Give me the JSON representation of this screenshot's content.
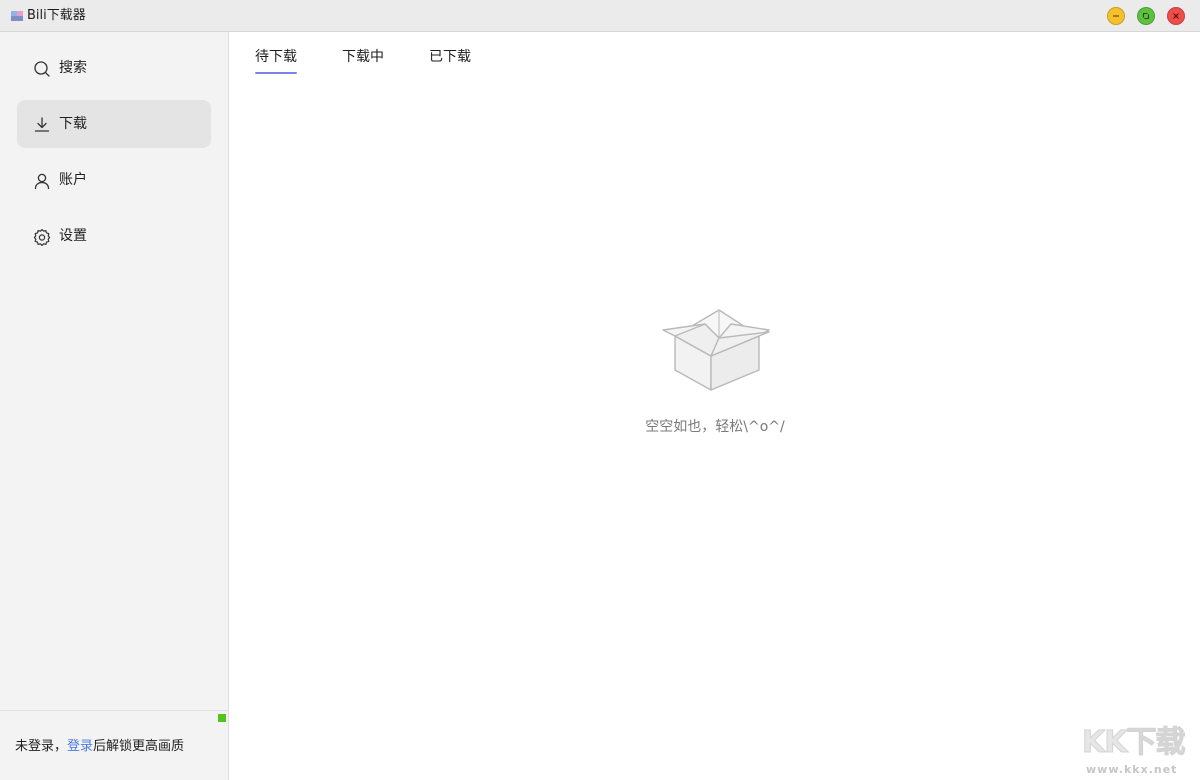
{
  "window": {
    "title": "Bili下载器",
    "buttons": {
      "minimize_icon": "minimize-icon",
      "maximize_icon": "maximize-icon",
      "close_icon": "close-icon"
    },
    "colors": {
      "minimize": "#f6c02d",
      "maximize": "#5fbf3e",
      "close": "#ee4d4a"
    }
  },
  "sidebar": {
    "items": [
      {
        "label": "搜索",
        "icon": "search-icon",
        "active": false
      },
      {
        "label": "下载",
        "icon": "download-icon",
        "active": true
      },
      {
        "label": "账户",
        "icon": "user-icon",
        "active": false
      },
      {
        "label": "设置",
        "icon": "gear-icon",
        "active": false
      }
    ],
    "footer": {
      "prefix": "未登录，",
      "link": "登录",
      "suffix": "后解锁更高画质",
      "status_color": "#52c41a"
    }
  },
  "main": {
    "tabs": [
      {
        "label": "待下载",
        "active": true
      },
      {
        "label": "下载中",
        "active": false
      },
      {
        "label": "已下载",
        "active": false
      }
    ],
    "empty": {
      "icon": "empty-box-icon",
      "text": "空空如也，轻松\\^o^/"
    },
    "accent_color": "#7c83e8"
  },
  "watermark": {
    "logo": "KK下载",
    "url": "www.kkx.net"
  }
}
